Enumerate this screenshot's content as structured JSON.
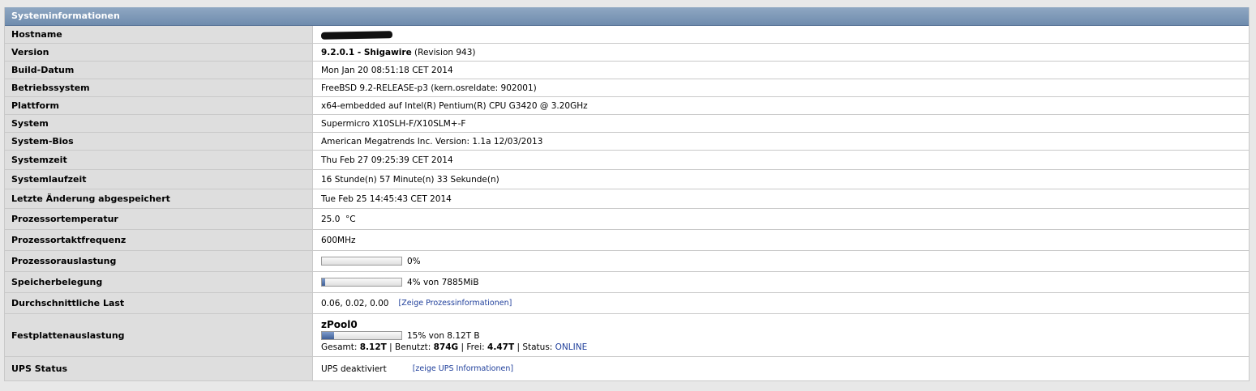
{
  "panel": {
    "title": "Systeminformationen"
  },
  "rows": {
    "hostname": {
      "label": "Hostname"
    },
    "version": {
      "label": "Version",
      "name": "9.2.0.1 - Shigawire",
      "revision": "(Revision 943)"
    },
    "build_date": {
      "label": "Build-Datum",
      "value": "Mon Jan 20 08:51:18 CET 2014"
    },
    "os": {
      "label": "Betriebssystem",
      "value": "FreeBSD 9.2-RELEASE-p3 (kern.osreldate: 902001)"
    },
    "platform": {
      "label": "Plattform",
      "value": "x64-embedded auf Intel(R) Pentium(R) CPU G3420 @ 3.20GHz"
    },
    "system": {
      "label": "System",
      "value": "Supermicro X10SLH-F/X10SLM+-F"
    },
    "bios": {
      "label": "System-Bios",
      "value": "American Megatrends Inc. Version: 1.1a 12/03/2013"
    },
    "system_time": {
      "label": "Systemzeit",
      "value": "Thu Feb 27 09:25:39 CET 2014"
    },
    "uptime": {
      "label": "Systemlaufzeit",
      "value": "16 Stunde(n) 57 Minute(n) 33 Sekunde(n)"
    },
    "last_saved": {
      "label": "Letzte Änderung abgespeichert",
      "value": "Tue Feb 25 14:45:43 CET 2014"
    },
    "cpu_temp": {
      "label": "Prozessortemperatur",
      "value": "25.0  °C"
    },
    "cpu_freq": {
      "label": "Prozessortaktfrequenz",
      "value": "600MHz"
    },
    "cpu_usage": {
      "label": "Prozessorauslastung",
      "percent_text": "0%",
      "fill": 0
    },
    "memory": {
      "label": "Speicherbelegung",
      "text": "4% von 7885MiB",
      "fill": 4
    },
    "load": {
      "label": "Durchschnittliche Last",
      "value": "0.06, 0.02, 0.00",
      "link": "[Zeige Prozessinformationen]"
    },
    "disk": {
      "label": "Festplattenauslastung",
      "pool": "zPool0",
      "text": "15% von 8.12T B",
      "fill": 15,
      "total_label": "Gesamt:",
      "total": "8.12T",
      "used_label": "| Benutzt:",
      "used": "874G",
      "free_label": "| Frei:",
      "free": "4.47T",
      "status_label": "| Status:",
      "status": "ONLINE"
    },
    "ups": {
      "label": "UPS Status",
      "value": "UPS deaktiviert",
      "link": "[zeige UPS Informationen]"
    }
  }
}
